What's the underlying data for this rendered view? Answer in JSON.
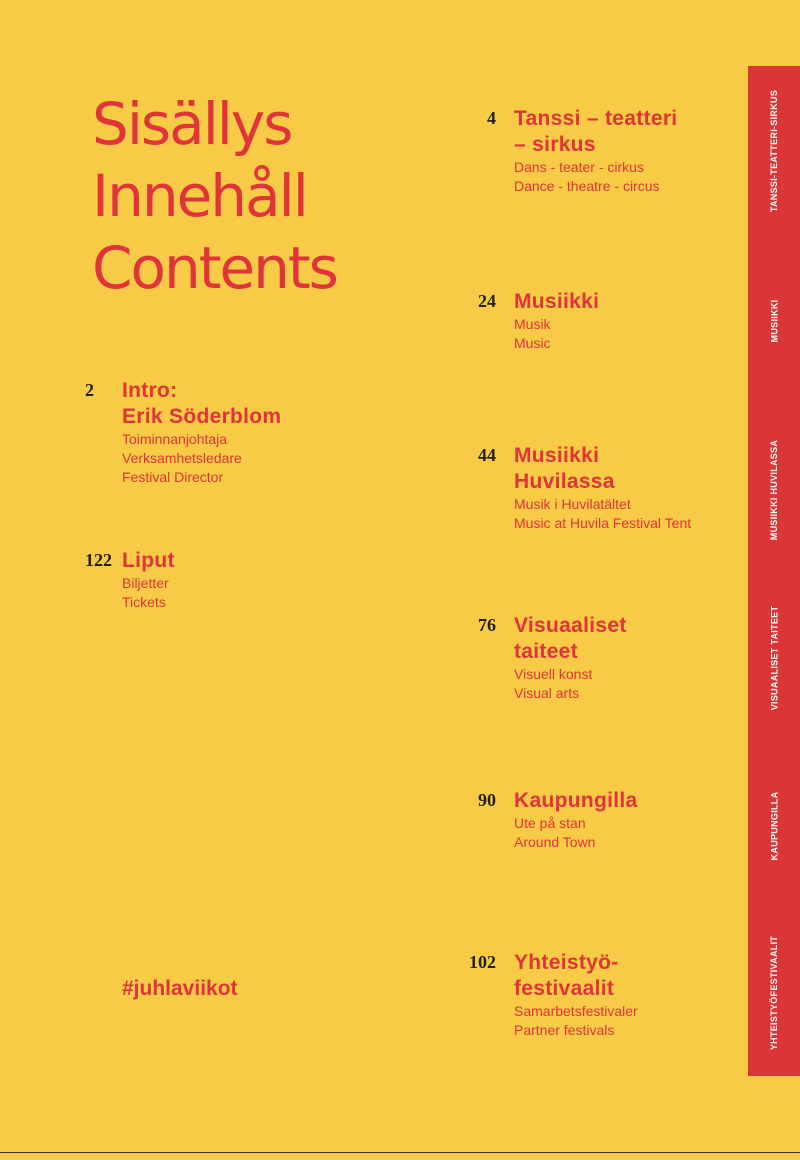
{
  "title": [
    "Sisällys",
    "Innehåll",
    "Contents"
  ],
  "left_entries": [
    {
      "page": "2",
      "title": [
        "Intro:",
        "Erik Söderblom"
      ],
      "sub": [
        "Toiminnanjohtaja",
        "Verksamhetsledare",
        "Festival Director"
      ]
    },
    {
      "page": "122",
      "title": [
        "Liput"
      ],
      "sub": [
        "Biljetter",
        "Tickets"
      ]
    }
  ],
  "right_entries": [
    {
      "page": "4",
      "title": [
        "Tanssi – teatteri",
        "– sirkus"
      ],
      "sub": [
        "Dans - teater - cirkus",
        "Dance - theatre - circus"
      ]
    },
    {
      "page": "24",
      "title": [
        "Musiikki"
      ],
      "sub": [
        "Musik",
        "Music"
      ]
    },
    {
      "page": "44",
      "title": [
        "Musiikki",
        "Huvilassa"
      ],
      "sub": [
        "Musik i Huvilatältet",
        "Music at Huvila Festival Tent"
      ]
    },
    {
      "page": "76",
      "title": [
        "Visuaaliset",
        "taiteet"
      ],
      "sub": [
        "Visuell konst",
        "Visual arts"
      ]
    },
    {
      "page": "90",
      "title": [
        "Kaupungilla"
      ],
      "sub": [
        "Ute på stan",
        "Around Town"
      ]
    },
    {
      "page": "102",
      "title": [
        "Yhteistyö-",
        "festivaalit"
      ],
      "sub": [
        "Samarbetsfestivaler",
        "Partner festivals"
      ]
    }
  ],
  "hashtag": "#juhlaviikot",
  "sidebar_tabs": [
    "TANSSI-TEATTERI-SIRKUS",
    "MUSIIKKI",
    "MUSIIKKI HUVILASSA",
    "VISUAALISET TAITEET",
    "KAUPUNGILLA",
    "YHTEISTYÖFESTIVAALIT"
  ],
  "colors": {
    "background": "#f7cb45",
    "accent": "#e0343a",
    "sidebar": "#db3636"
  }
}
